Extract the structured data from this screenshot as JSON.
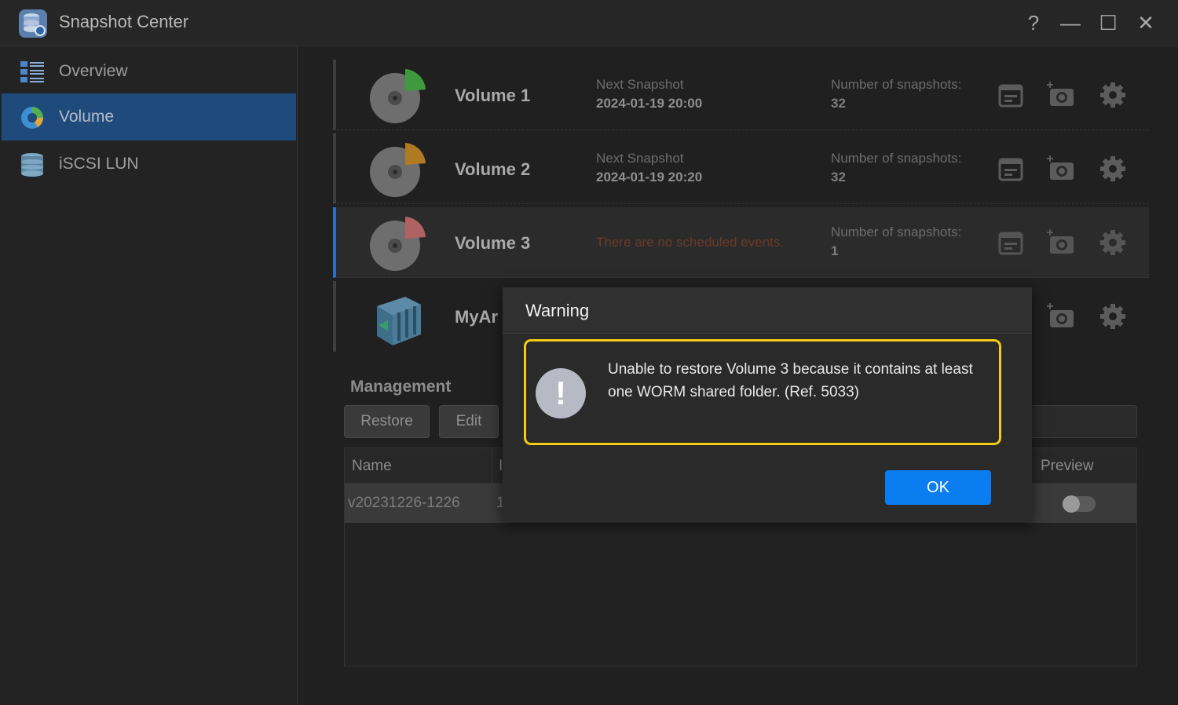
{
  "app": {
    "title": "Snapshot Center"
  },
  "window_controls": {
    "help": "?",
    "minimize": "—",
    "maximize": "☐",
    "close": "✕"
  },
  "sidebar": {
    "items": [
      {
        "label": "Overview",
        "icon": "list-icon",
        "active": false
      },
      {
        "label": "Volume",
        "icon": "volume-pie-icon",
        "active": true
      },
      {
        "label": "iSCSI LUN",
        "icon": "database-icon",
        "active": false
      }
    ]
  },
  "volumes": [
    {
      "name": "Volume 1",
      "next_label": "Next Snapshot",
      "next_value": "2024-01-19 20:00",
      "count_label": "Number of snapshots:",
      "count": "32",
      "accent": "#3e9a3c"
    },
    {
      "name": "Volume 2",
      "next_label": "Next Snapshot",
      "next_value": "2024-01-19 20:20",
      "count_label": "Number of snapshots:",
      "count": "32",
      "accent": "#b07a22"
    },
    {
      "name": "Volume 3",
      "no_events": "There are no scheduled events.",
      "count_label": "Number of snapshots:",
      "count": "1",
      "accent": "#b06262"
    },
    {
      "name": "MyAr"
    }
  ],
  "management": {
    "title": "Management",
    "restore_label": "Restore",
    "edit_label": "Edit",
    "columns": {
      "name": "Name",
      "col2": "I",
      "preview": "Preview"
    },
    "rows": [
      {
        "name": "v20231226-1226",
        "col2": "1"
      }
    ]
  },
  "modal": {
    "title": "Warning",
    "icon": "!",
    "message": "Unable to restore Volume 3 because it contains at least one WORM shared folder. (Ref. 5033)",
    "ok_label": "OK"
  },
  "colors": {
    "accent": "#0a7ef0",
    "highlight": "#f2cc15",
    "active_nav": "#1e4a7c"
  }
}
